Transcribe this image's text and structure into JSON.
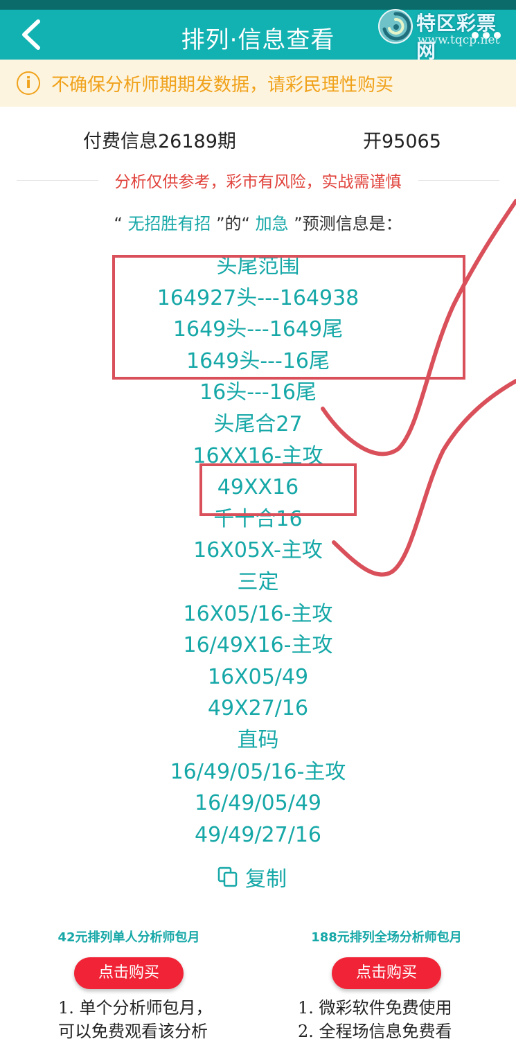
{
  "header": {
    "title": "排列·信息查看",
    "back_icon": "chevron-left-icon",
    "more_icon": "more-dots-icon"
  },
  "watermark": {
    "name": "特区彩票网",
    "url": "www.tqcp.net"
  },
  "notice": {
    "icon": "info-circle-icon",
    "icon_glyph": "i",
    "text": "不确保分析师期期发数据，请彩民理性购买"
  },
  "issue": {
    "label": "付费信息26189期",
    "result": "开95065"
  },
  "warning": "分析仅供参考，彩市有风险，实战需谨慎",
  "predict": {
    "quote_open_1": "“ ",
    "analyst": "无招胜有招",
    "quote_close_1": " ”的“ ",
    "category": "加急",
    "quote_close_2": " ”预测信息是："
  },
  "prediction_lines": [
    "头尾范围",
    "164927头---164938",
    "1649头---1649尾",
    "1649头---16尾",
    "16头---16尾",
    "头尾合27",
    "16XX16-主攻",
    "49XX16",
    "千十合16",
    "16X05X-主攻",
    "三定",
    "16X05/16-主攻",
    "16/49X16-主攻",
    "16X05/49",
    "49X27/16",
    "直码",
    "16/49/05/16-主攻",
    "16/49/05/49",
    "49/49/27/16"
  ],
  "copy": {
    "label": "复制",
    "icon": "copy-icon"
  },
  "plans": [
    {
      "title": "42元排列单人分析师包月",
      "button": "点击购买",
      "lines": [
        "1. 单个分析师包月，",
        "可以免费观看该分析"
      ]
    },
    {
      "title": "188元排列全场分析师包月",
      "button": "点击购买",
      "lines": [
        "1. 微彩软件免费使用",
        "2. 全程场信息免费看"
      ]
    }
  ],
  "colors": {
    "header": "#13b2b2",
    "accent": "#16a7a7",
    "notice_bg": "#fdf4df",
    "notice_text": "#f0a21b",
    "warning_text": "#e0413a",
    "buy_button": "#f02436",
    "annotation": "#d9505a"
  }
}
